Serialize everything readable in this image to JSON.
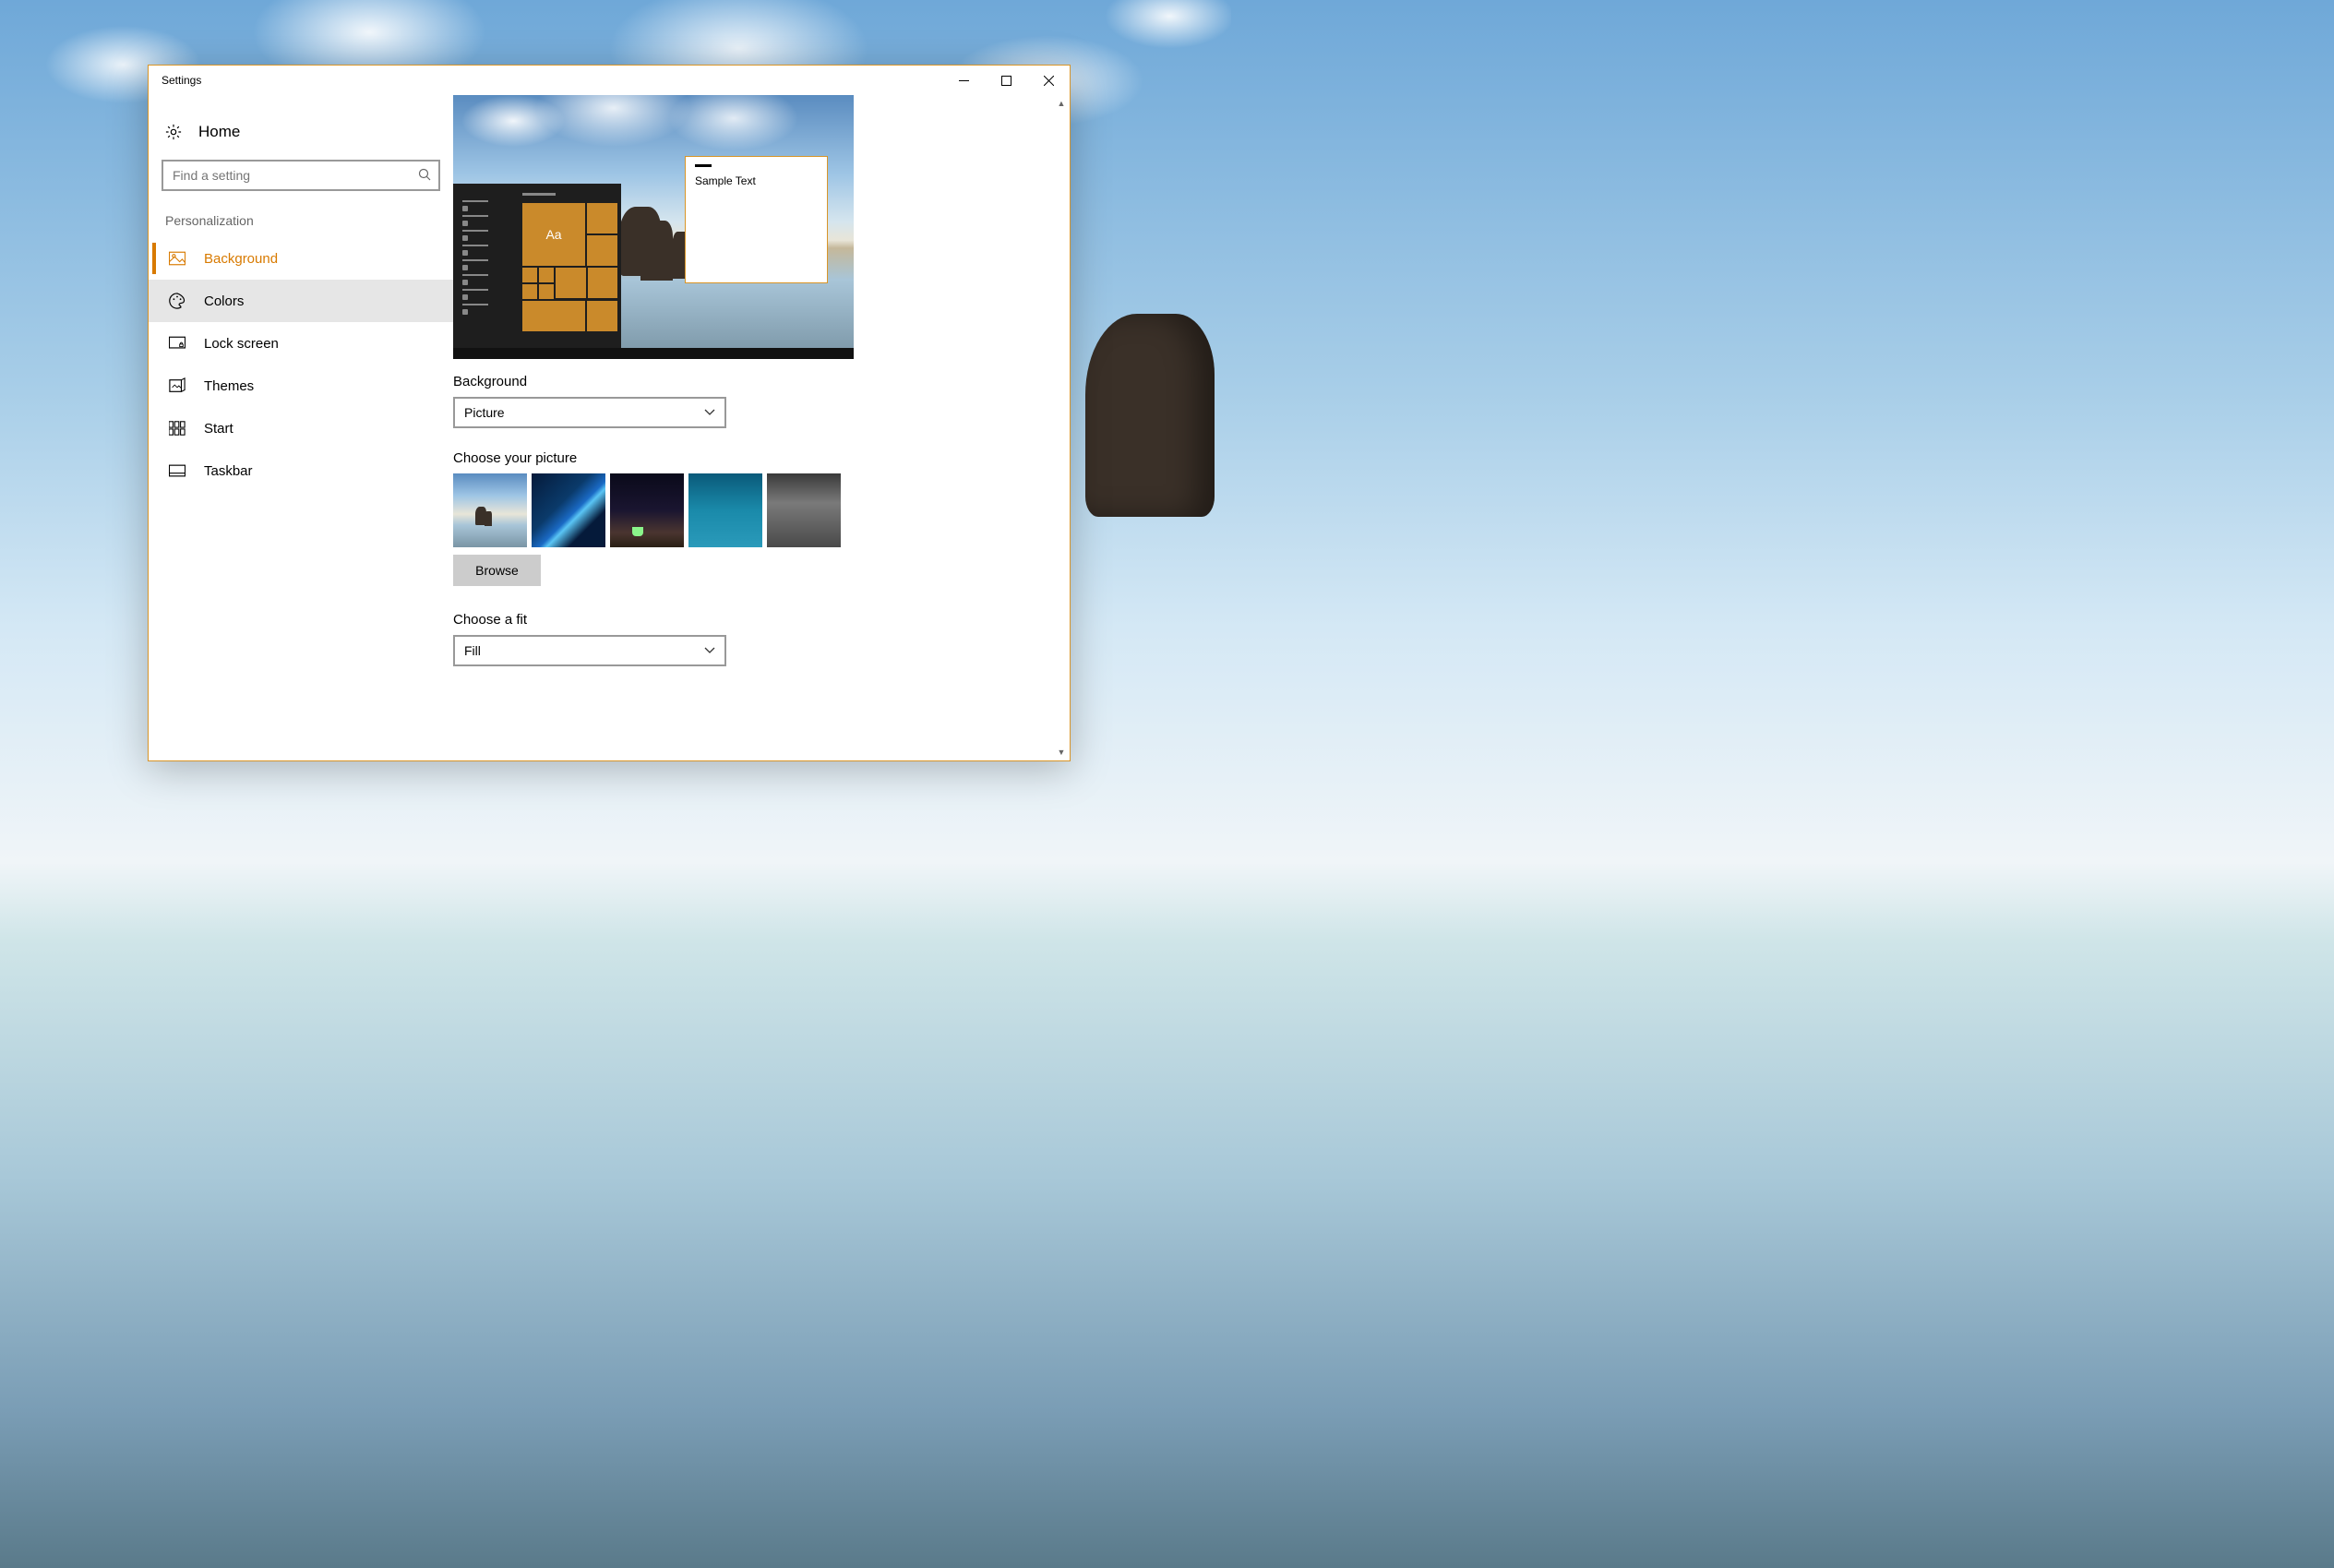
{
  "window": {
    "title": "Settings"
  },
  "sidebar": {
    "home_label": "Home",
    "search_placeholder": "Find a setting",
    "category": "Personalization",
    "items": [
      {
        "label": "Background",
        "icon": "picture-icon",
        "active": true
      },
      {
        "label": "Colors",
        "icon": "palette-icon",
        "hover": true
      },
      {
        "label": "Lock screen",
        "icon": "lockscreen-icon"
      },
      {
        "label": "Themes",
        "icon": "themes-icon"
      },
      {
        "label": "Start",
        "icon": "start-icon"
      },
      {
        "label": "Taskbar",
        "icon": "taskbar-icon"
      }
    ]
  },
  "content": {
    "preview": {
      "sample_text": "Sample Text",
      "tile_text": "Aa"
    },
    "background_label": "Background",
    "background_value": "Picture",
    "choose_picture_label": "Choose your picture",
    "browse_label": "Browse",
    "choose_fit_label": "Choose a fit",
    "fit_value": "Fill"
  }
}
